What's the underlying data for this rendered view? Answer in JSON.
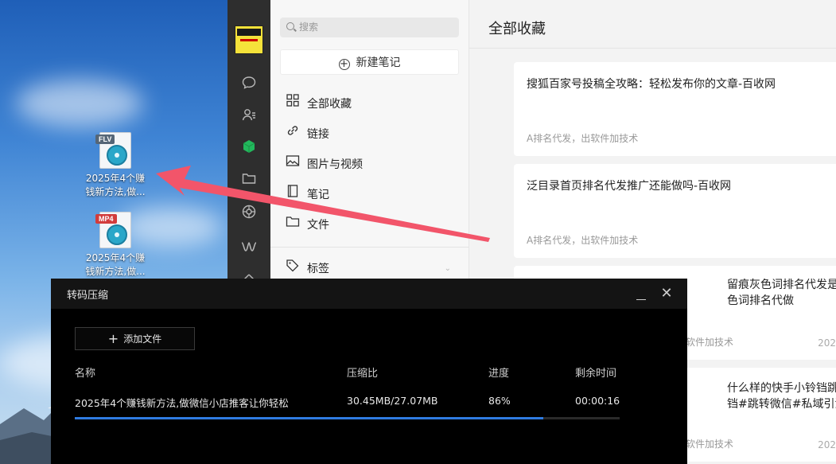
{
  "desktop": {
    "icons": [
      {
        "type_tag": "FLV",
        "tag_color": "#556677",
        "label_line1": "2025年4个赚",
        "label_line2": "钱新方法,做..."
      },
      {
        "type_tag": "MP4",
        "tag_color": "#d23c3c",
        "label_line1": "2025年4个赚",
        "label_line2": "钱新方法,做..."
      }
    ]
  },
  "app": {
    "rail_icons": [
      "chat-icon",
      "contacts-icon",
      "favorites-cube-icon",
      "folder-icon",
      "moments-icon",
      "mini-program-icon",
      "more-icon"
    ],
    "search": {
      "placeholder": "搜索"
    },
    "new_note_label": "新建笔记",
    "nav": {
      "all": "全部收藏",
      "links": "链接",
      "media": "图片与视频",
      "notes": "笔记",
      "files": "文件",
      "tags": "标签"
    },
    "content_title": "全部收藏",
    "cards": [
      {
        "title": "搜狐百家号投稿全攻略：轻松发布你的文章-百收网",
        "tags": "A排名代发，出软件加技术",
        "date": ""
      },
      {
        "title": "泛目录首页排名代发推广还能做吗-百收网",
        "tags": "A排名代发，出软件加技术",
        "date": ""
      },
      {
        "title": "留痕灰色词排名代发是什么",
        "title2": "色词排名代做",
        "tags": "软件加技术",
        "date": "202"
      },
      {
        "title": "什么样的快手小铃铛跳转微信",
        "title2": "铛#跳转微信#私域引流",
        "tags": "软件加技术",
        "date": "202"
      }
    ]
  },
  "dialog": {
    "title": "转码压缩",
    "add_file_label": "添加文件",
    "columns": {
      "name": "名称",
      "ratio": "压缩比",
      "progress": "进度",
      "remaining": "剩余时间"
    },
    "row": {
      "name": "2025年4个赚钱新方法,做微信小店推客让你轻松",
      "ratio": "30.45MB/27.07MB",
      "progress_text": "86%",
      "progress_value": 86,
      "remaining": "00:00:16"
    },
    "accent_color": "#2f7be0"
  },
  "annotation_arrow_color": "#f2556a"
}
